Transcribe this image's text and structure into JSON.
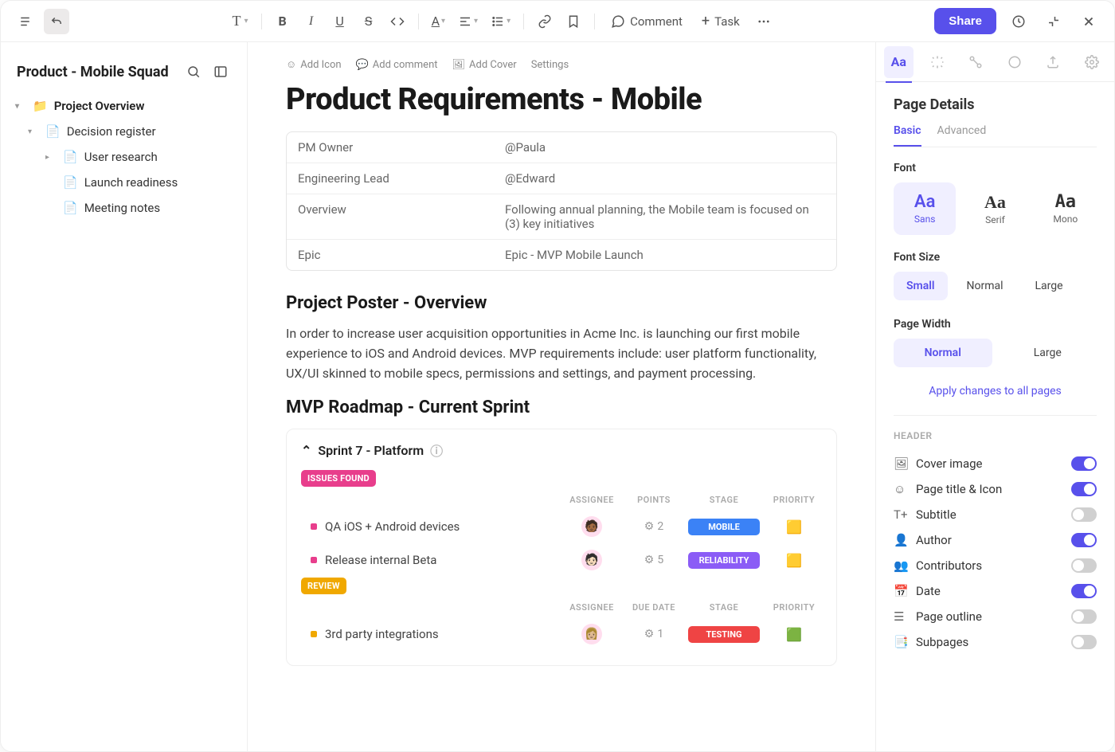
{
  "topbar": {
    "comment": "Comment",
    "task": "Task",
    "share": "Share"
  },
  "sidebar": {
    "title": "Product - Mobile Squad",
    "items": [
      {
        "label": "Project Overview",
        "root": true
      },
      {
        "label": "Decision register",
        "indent": 1
      },
      {
        "label": "User research",
        "indent": 2,
        "caret": true
      },
      {
        "label": "Launch readiness",
        "indent": 2
      },
      {
        "label": "Meeting notes",
        "indent": 2
      }
    ]
  },
  "meta": {
    "addIcon": "Add Icon",
    "addComment": "Add comment",
    "addCover": "Add Cover",
    "settings": "Settings"
  },
  "page": {
    "title": "Product Requirements - Mobile",
    "rows": [
      {
        "k": "PM Owner",
        "v": "@Paula"
      },
      {
        "k": "Engineering Lead",
        "v": "@Edward"
      },
      {
        "k": "Overview",
        "v": "Following annual planning, the Mobile team is focused on (3) key initiatives"
      },
      {
        "k": "Epic",
        "v": "Epic - MVP Mobile Launch"
      }
    ]
  },
  "poster": {
    "heading": "Project Poster - Overview",
    "body": "In order to increase user acquisition opportunities in Acme Inc. is launching our first mobile experience to iOS and Android devices. MVP requirements include: user platform functionality, UX/UI skinned to mobile specs, permissions and settings, and payment processing."
  },
  "roadmap": {
    "heading": "MVP Roadmap - Current Sprint",
    "sprintTitle": "Sprint  7 - Platform",
    "groups": [
      {
        "badge": "ISSUES FOUND",
        "badgeClass": "pink",
        "headers": [
          "ASSIGNEE",
          "POINTS",
          "STAGE",
          "PRIORITY"
        ],
        "rows": [
          {
            "name": "QA iOS + Android devices",
            "points": "2",
            "stage": "MOBILE",
            "stageClass": "stage-mobile",
            "avatar": "🧑🏾",
            "flag": "🟨",
            "sq": "pink"
          },
          {
            "name": "Release internal Beta",
            "points": "5",
            "stage": "RELIABILITY",
            "stageClass": "stage-reliability",
            "avatar": "🧑🏻",
            "flag": "🟨",
            "sq": "pink"
          }
        ]
      },
      {
        "badge": "REVIEW",
        "badgeClass": "yellow",
        "headers": [
          "ASSIGNEE",
          "DUE DATE",
          "STAGE",
          "PRIORITY"
        ],
        "rows": [
          {
            "name": "3rd party integrations",
            "points": "1",
            "stage": "TESTING",
            "stageClass": "stage-testing",
            "avatar": "👩🏼",
            "flag": "🟩",
            "sq": "yellow"
          }
        ]
      }
    ]
  },
  "panel": {
    "title": "Page Details",
    "tabs": {
      "basic": "Basic",
      "advanced": "Advanced"
    },
    "fontLabel": "Font",
    "fonts": [
      {
        "name": "Sans",
        "active": true
      },
      {
        "name": "Serif"
      },
      {
        "name": "Mono"
      }
    ],
    "fontSizeLabel": "Font Size",
    "fontSizes": [
      {
        "name": "Small",
        "active": true
      },
      {
        "name": "Normal"
      },
      {
        "name": "Large"
      }
    ],
    "widthLabel": "Page Width",
    "widths": [
      {
        "name": "Normal",
        "active": true
      },
      {
        "name": "Large"
      }
    ],
    "applyAll": "Apply changes to all pages",
    "headerLabel": "HEADER",
    "toggles": [
      {
        "label": "Cover image",
        "on": true,
        "icon": "image"
      },
      {
        "label": "Page title & Icon",
        "on": true,
        "icon": "smile"
      },
      {
        "label": "Subtitle",
        "on": false,
        "icon": "text"
      },
      {
        "label": "Author",
        "on": true,
        "icon": "user"
      },
      {
        "label": "Contributors",
        "on": false,
        "icon": "users"
      },
      {
        "label": "Date",
        "on": true,
        "icon": "calendar"
      },
      {
        "label": "Page outline",
        "on": false,
        "icon": "list"
      },
      {
        "label": "Subpages",
        "on": false,
        "icon": "pages"
      }
    ]
  }
}
